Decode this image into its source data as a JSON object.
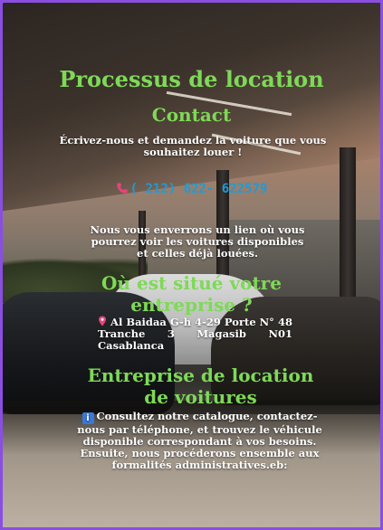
{
  "page": {
    "title": "Processus de location"
  },
  "contact": {
    "heading": "Contact",
    "intro": "Écrivez-nous et demandez la voiture que vous souhaitez louer !",
    "phone": "( 212) 622- 622579",
    "followup": "Nous vous enverrons un lien où vous pourrez voir les voitures disponibles et celles déjà louées."
  },
  "location": {
    "heading": "Où est situé votre entreprise ?",
    "address": "Al Baidaa G-h 4-29 Porte N° 48 Tranche 3 Magasib N01 Casablanca"
  },
  "company": {
    "heading": "Entreprise de location de voitures",
    "info_icon_glyph": "i",
    "description": "Consultez notre catalogue, contactez-nous par téléphone, et trouvez le véhicule disponible correspondant à vos besoins. Ensuite, nous procéderons ensemble aux formalités administratives.eb:"
  },
  "icons": {
    "phone": "phone-icon",
    "pin": "pin-icon",
    "info": "info-icon"
  },
  "colors": {
    "border": "#8a4fe0",
    "heading": "#7ed957",
    "phone": "#1e9bd7",
    "text": "#ffffff"
  }
}
